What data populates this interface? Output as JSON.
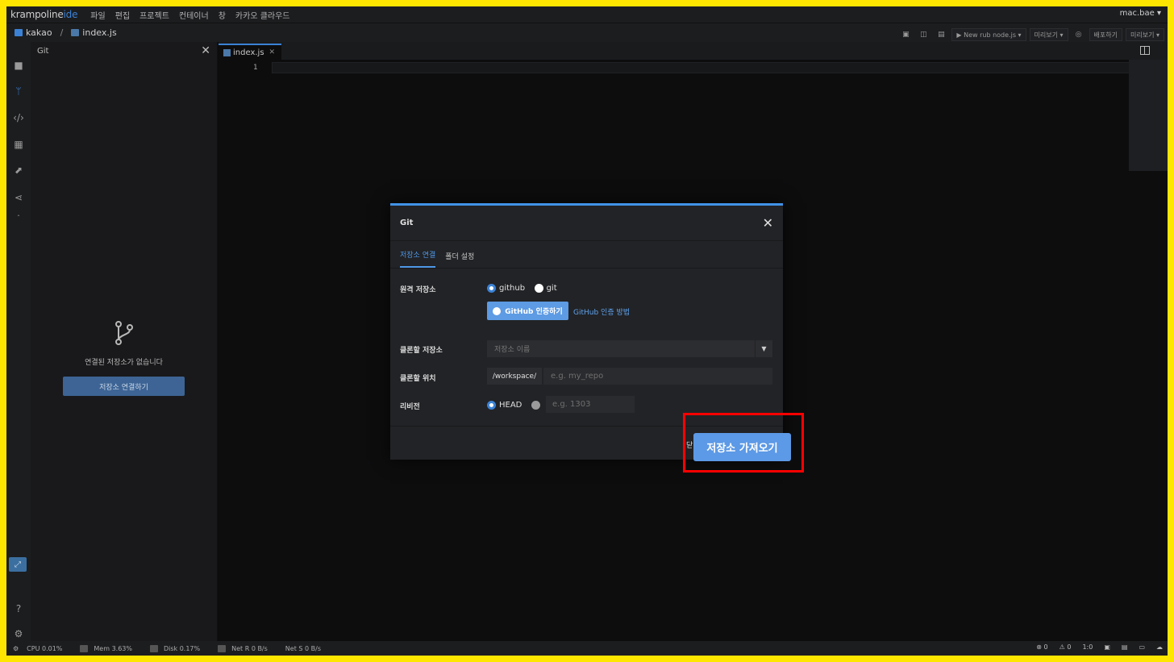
{
  "app": {
    "logo_main": "krampoline",
    "logo_accent": "ide",
    "menu": [
      "파일",
      "편집",
      "프로젝트",
      "컨테이너",
      "창",
      "카카오 클라우드"
    ],
    "user": "mac.bae ▾"
  },
  "toolbar": {
    "project": "kakao",
    "separator": "/",
    "file": "index.js",
    "run_label": "▶ New rub node.js ▾",
    "preview_label": "미리보기 ▾",
    "deploy_label": "배포하기",
    "preview2_label": "미리보기 ▾"
  },
  "git_panel": {
    "title": "Git",
    "empty_message": "연결된 저장소가 없습니다",
    "connect_button": "저장소 연결하기"
  },
  "editor": {
    "tab_label": "index.js",
    "line_number": "1"
  },
  "status_bar": {
    "cpu": "CPU 0.01%",
    "mem": "Mem 3.63%",
    "disk": "Disk 0.17%",
    "net_r": "Net R 0 B/s",
    "net_s": "Net S 0 B/s",
    "errors": "0",
    "warnings": "0",
    "position": "1:0"
  },
  "modal": {
    "title": "Git",
    "tabs": [
      "저장소 연결",
      "폴더 설정"
    ],
    "remote_label": "원격 저장소",
    "radio_github": "github",
    "radio_git": "git",
    "github_auth_button": "GitHub 인증하기",
    "github_auth_link": "GitHub 인증 방법",
    "clone_repo_label": "클론할 저장소",
    "clone_repo_placeholder": "저장소 이름",
    "clone_location_label": "클론할 위치",
    "workspace_prefix": "/workspace/",
    "location_placeholder": "e.g. my_repo",
    "revision_label": "리비전",
    "revision_head": "HEAD",
    "revision_placeholder": "e.g. 1303",
    "close_label": "닫",
    "import_button": "저장소 가져오기"
  },
  "colors": {
    "accent": "#3b82d6",
    "button_primary": "#5c99e6",
    "highlight_box": "#ff0000",
    "border_frame": "#ffe600"
  }
}
